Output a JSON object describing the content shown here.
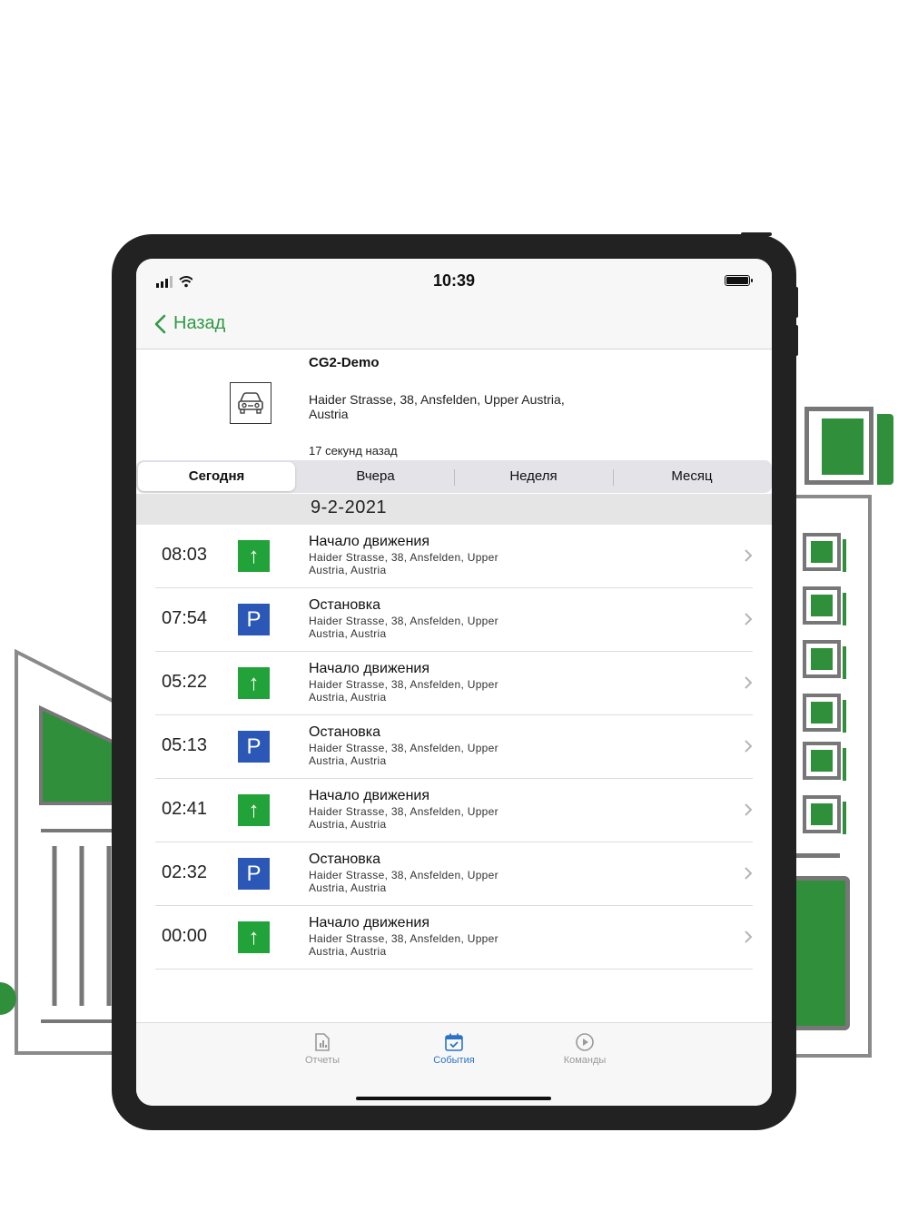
{
  "status": {
    "time": "10:39"
  },
  "nav": {
    "back_label": "Назад"
  },
  "vehicle": {
    "name": "CG2-Demo",
    "address": "Haider Strasse, 38, Ansfelden, Upper Austria, Austria",
    "updated": "17 секунд назад",
    "icon": "car-icon"
  },
  "segments": [
    {
      "label": "Сегодня",
      "active": true
    },
    {
      "label": "Вчера",
      "active": false
    },
    {
      "label": "Неделя",
      "active": false
    },
    {
      "label": "Месяц",
      "active": false
    }
  ],
  "date": "9-2-2021",
  "events": [
    {
      "time": "08:03",
      "type": "go",
      "icon": "↑",
      "title": "Начало движения",
      "address": "Haider Strasse, 38, Ansfelden, Upper Austria, Austria"
    },
    {
      "time": "07:54",
      "type": "stop",
      "icon": "P",
      "title": "Остановка",
      "address": "Haider Strasse, 38, Ansfelden, Upper Austria, Austria"
    },
    {
      "time": "05:22",
      "type": "go",
      "icon": "↑",
      "title": "Начало движения",
      "address": "Haider Strasse, 38, Ansfelden, Upper Austria, Austria"
    },
    {
      "time": "05:13",
      "type": "stop",
      "icon": "P",
      "title": "Остановка",
      "address": "Haider Strasse, 38, Ansfelden, Upper Austria, Austria"
    },
    {
      "time": "02:41",
      "type": "go",
      "icon": "↑",
      "title": "Начало движения",
      "address": "Haider Strasse, 38, Ansfelden, Upper Austria, Austria"
    },
    {
      "time": "02:32",
      "type": "stop",
      "icon": "P",
      "title": "Остановка",
      "address": "Haider Strasse, 38, Ansfelden, Upper Austria, Austria"
    },
    {
      "time": "00:00",
      "type": "go",
      "icon": "↑",
      "title": "Начало движения",
      "address": "Haider Strasse, 38, Ansfelden, Upper Austria, Austria"
    }
  ],
  "tabs": [
    {
      "label": "Отчеты",
      "icon": "report-icon",
      "active": false
    },
    {
      "label": "События",
      "icon": "calendar-icon",
      "active": true
    },
    {
      "label": "Команды",
      "icon": "play-icon",
      "active": false
    }
  ],
  "colors": {
    "accent_green": "#2f9a45",
    "go_green": "#22a33a",
    "stop_blue": "#2b57b6",
    "tab_active": "#2a73c7"
  }
}
